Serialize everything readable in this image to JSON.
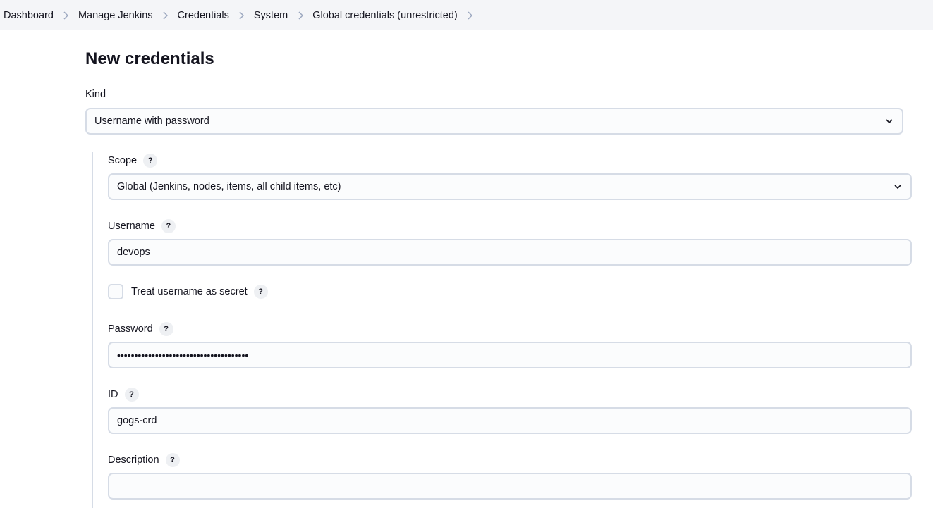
{
  "breadcrumb": {
    "items": [
      "Dashboard",
      "Manage Jenkins",
      "Credentials",
      "System",
      "Global credentials (unrestricted)"
    ]
  },
  "page": {
    "title": "New credentials"
  },
  "form": {
    "kind": {
      "label": "Kind",
      "value": "Username with password"
    },
    "scope": {
      "label": "Scope",
      "value": "Global (Jenkins, nodes, items, all child items, etc)"
    },
    "username": {
      "label": "Username",
      "value": "devops"
    },
    "treat_secret": {
      "label": "Treat username as secret",
      "checked": false
    },
    "password": {
      "label": "Password",
      "value": "••••••••••••••••••••••••••••••••••••••"
    },
    "id": {
      "label": "ID",
      "value": "gogs-crd"
    },
    "description": {
      "label": "Description",
      "value": ""
    },
    "help_glyph": "?"
  },
  "colors": {
    "breadcrumb_bg": "#f4f5f8",
    "border": "#d6dce6",
    "text": "#14141f",
    "chevron": "#9ba7bf"
  }
}
